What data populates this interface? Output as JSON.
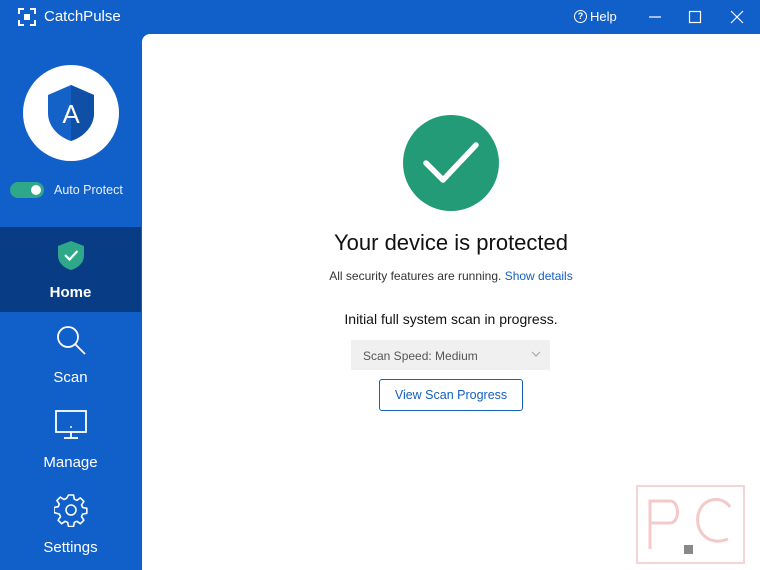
{
  "window": {
    "title": "CatchPulse",
    "help_label": "Help",
    "minimize": "minimize",
    "maximize": "maximize",
    "close": "close"
  },
  "sidebar": {
    "avatar_icon": "shield-letter-icon",
    "avatar_letter": "A",
    "auto_protect": {
      "label": "Auto Protect",
      "enabled": true
    },
    "items": [
      {
        "label": "Home",
        "icon": "shield-check-icon",
        "active": true
      },
      {
        "label": "Scan",
        "icon": "search-icon",
        "active": false
      },
      {
        "label": "Manage",
        "icon": "monitor-icon",
        "active": false
      },
      {
        "label": "Settings",
        "icon": "gear-icon",
        "active": false
      }
    ]
  },
  "main": {
    "status_icon": "checkmark-icon",
    "headline": "Your device is protected",
    "subtitle": "All security features are running.",
    "details_link": "Show details",
    "scan_message": "Initial full system scan in progress.",
    "scan_speed": "Scan Speed: Medium",
    "view_button": "View Scan Progress"
  },
  "colors": {
    "sidebar_bg": "#1160c9",
    "active_nav": "#083d86",
    "accent_green": "#239b76",
    "link_blue": "#1560bd"
  }
}
